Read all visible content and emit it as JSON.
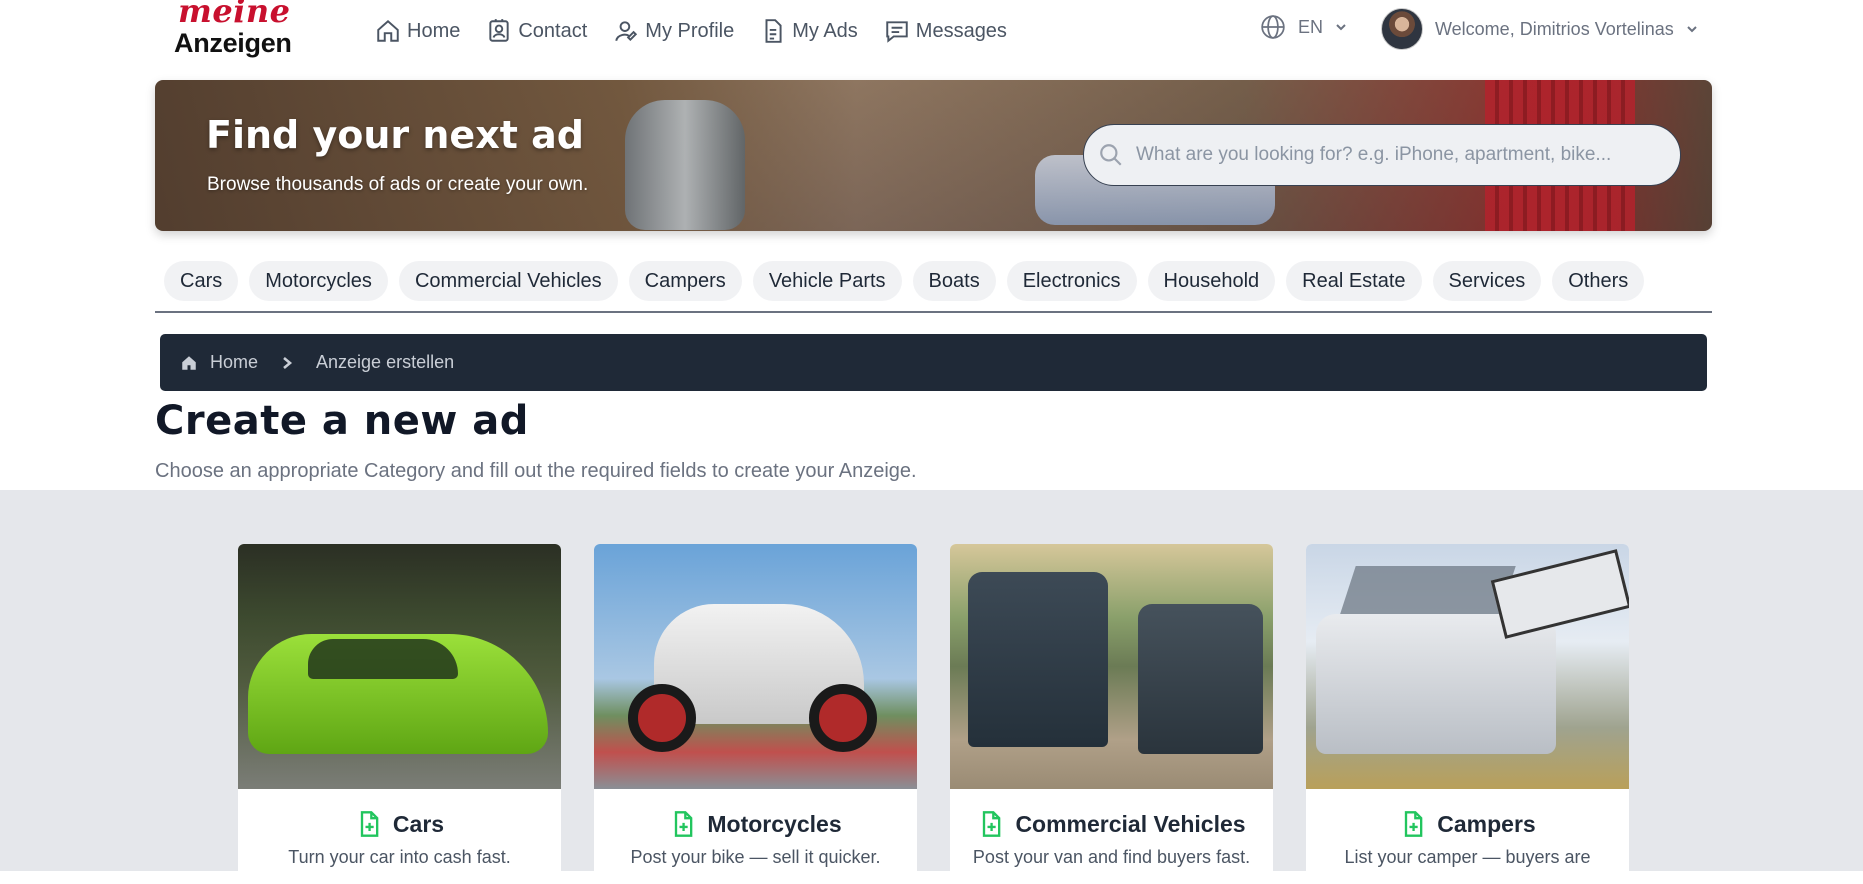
{
  "header": {
    "logo_top": "meine",
    "logo_bottom": "Anzeigen",
    "nav": [
      {
        "label": "Home",
        "icon": "home-icon"
      },
      {
        "label": "Contact",
        "icon": "contact-icon"
      },
      {
        "label": "My Profile",
        "icon": "profile-icon"
      },
      {
        "label": "My Ads",
        "icon": "ads-icon"
      },
      {
        "label": "Messages",
        "icon": "messages-icon"
      }
    ],
    "language": "EN",
    "welcome": "Welcome, Dimitrios Vortelinas"
  },
  "hero": {
    "title": "Find your next ad",
    "subtitle": "Browse thousands of ads or create your own.",
    "search_placeholder": "What are you looking for? e.g. iPhone, apartment, bike..."
  },
  "categories": [
    "Cars",
    "Motorcycles",
    "Commercial Vehicles",
    "Campers",
    "Vehicle Parts",
    "Boats",
    "Electronics",
    "Household",
    "Real Estate",
    "Services",
    "Others"
  ],
  "breadcrumb": {
    "home": "Home",
    "current": "Anzeige erstellen"
  },
  "page": {
    "title": "Create a new ad",
    "description": "Choose an appropriate Category and fill out the required fields to create your Anzeige."
  },
  "cards": [
    {
      "title": "Cars",
      "description": "Turn your car into cash fast."
    },
    {
      "title": "Motorcycles",
      "description": "Post your bike — sell it quicker."
    },
    {
      "title": "Commercial Vehicles",
      "description": "Post your van and find buyers fast."
    },
    {
      "title": "Campers",
      "description": "List your camper — buyers are"
    }
  ],
  "colors": {
    "brand_red": "#c8102e",
    "breadcrumb_bg": "#1f2937",
    "card_icon": "#22c55e",
    "cards_bg": "#e5e7eb"
  }
}
